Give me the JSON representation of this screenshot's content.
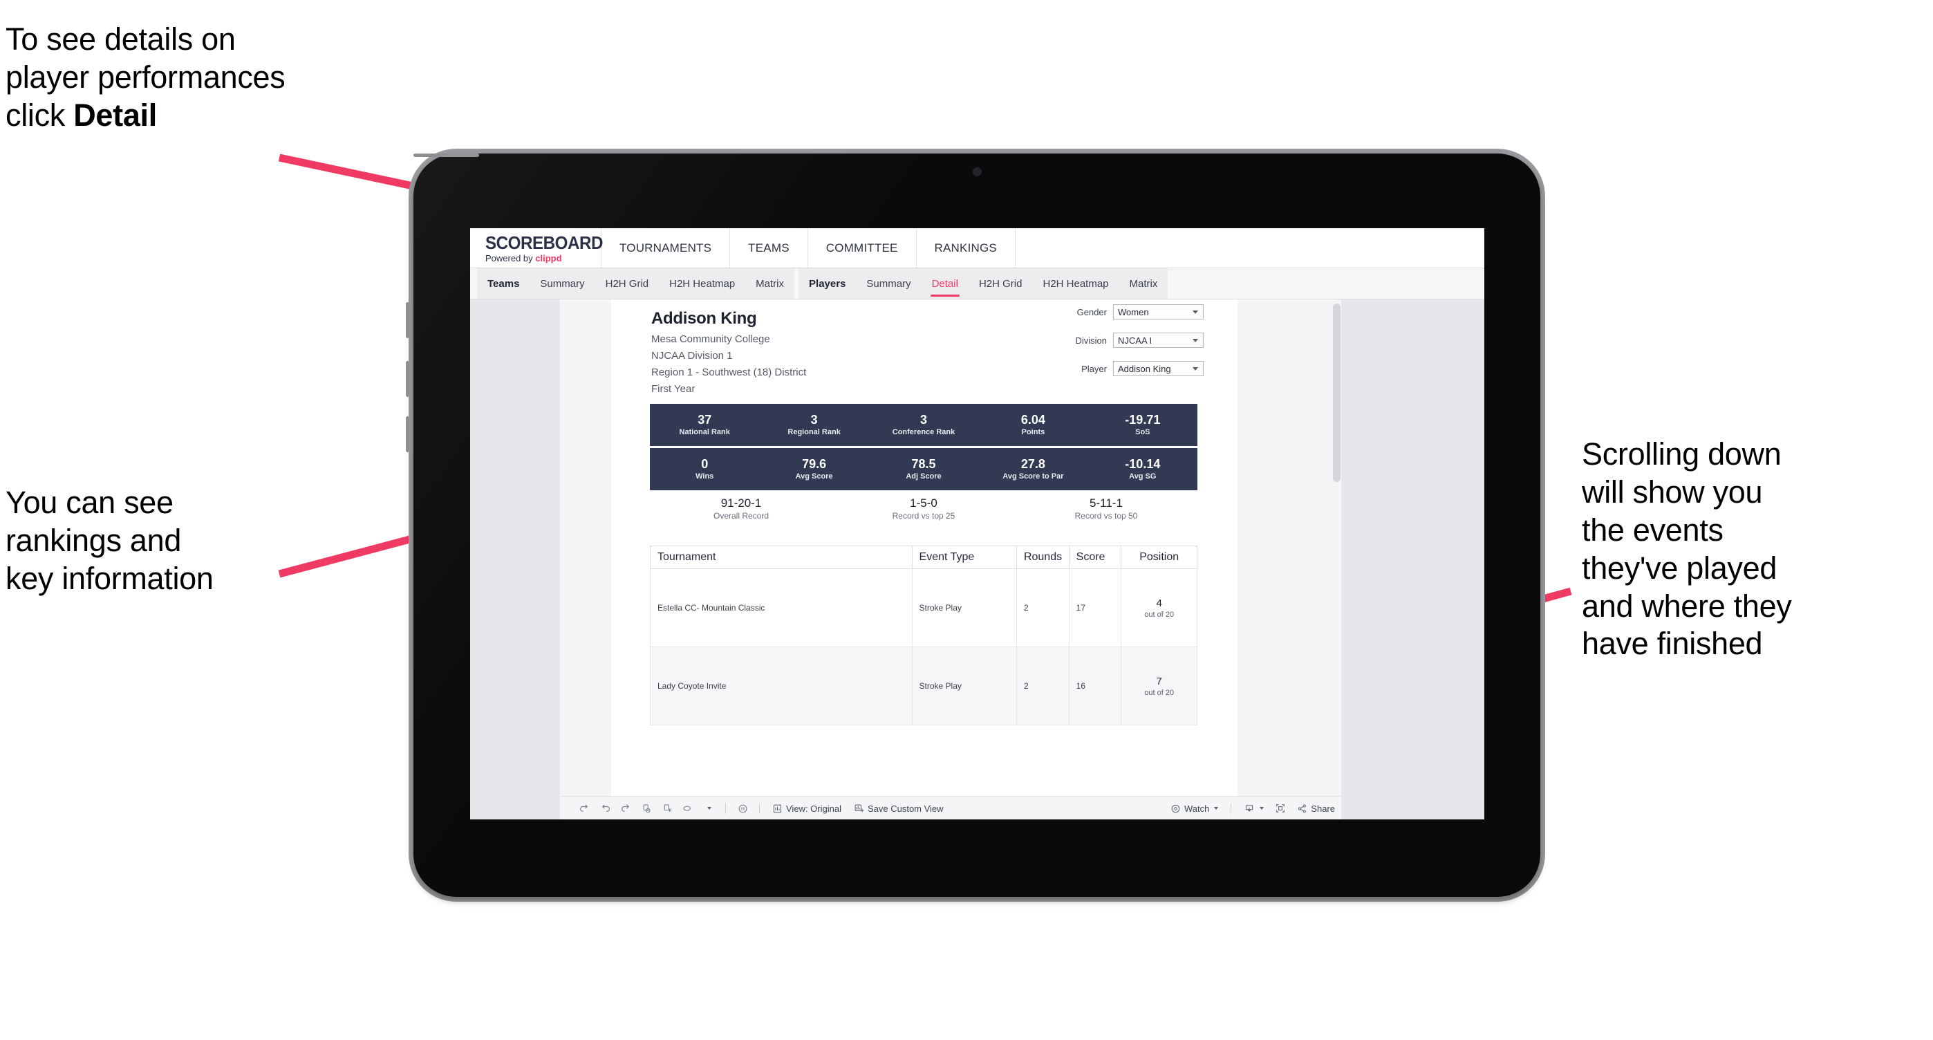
{
  "annotations": {
    "top_left": "To see details on\nplayer performances\nclick ",
    "top_left_bold": "Detail",
    "mid_left": "You can see\nrankings and\nkey information",
    "right": "Scrolling down\nwill show you\nthe events\nthey've played\nand where they\nhave finished",
    "arrow_color": "#ef3a63"
  },
  "header": {
    "brand_title": "SCOREBOARD",
    "brand_sub_prefix": "Powered by ",
    "brand_sub_accent": "clippd",
    "nav": [
      {
        "label": "TOURNAMENTS"
      },
      {
        "label": "TEAMS"
      },
      {
        "label": "COMMITTEE"
      },
      {
        "label": "RANKINGS"
      }
    ]
  },
  "tabbar": {
    "group_teams": [
      {
        "label": "Teams",
        "active": false,
        "head": true
      },
      {
        "label": "Summary",
        "active": false,
        "head": false
      },
      {
        "label": "H2H Grid",
        "active": false,
        "head": false
      },
      {
        "label": "H2H Heatmap",
        "active": false,
        "head": false
      },
      {
        "label": "Matrix",
        "active": false,
        "head": false
      }
    ],
    "group_players": [
      {
        "label": "Players",
        "active": false,
        "head": true
      },
      {
        "label": "Summary",
        "active": false,
        "head": false
      },
      {
        "label": "Detail",
        "active": true,
        "head": false
      },
      {
        "label": "H2H Grid",
        "active": false,
        "head": false
      },
      {
        "label": "H2H Heatmap",
        "active": false,
        "head": false
      },
      {
        "label": "Matrix",
        "active": false,
        "head": false
      }
    ]
  },
  "player": {
    "name": "Addison King",
    "school": "Mesa Community College",
    "division": "NJCAA Division 1",
    "region": "Region 1 - Southwest (18) District",
    "year": "First Year"
  },
  "selectors": [
    {
      "label": "Gender",
      "value": "Women"
    },
    {
      "label": "Division",
      "value": "NJCAA I"
    },
    {
      "label": "Player",
      "value": "Addison King"
    }
  ],
  "stats_band_1": [
    {
      "value": "37",
      "label": "National Rank"
    },
    {
      "value": "3",
      "label": "Regional Rank"
    },
    {
      "value": "3",
      "label": "Conference Rank"
    },
    {
      "value": "6.04",
      "label": "Points"
    },
    {
      "value": "-19.71",
      "label": "SoS"
    }
  ],
  "stats_band_2": [
    {
      "value": "0",
      "label": "Wins"
    },
    {
      "value": "79.6",
      "label": "Avg Score"
    },
    {
      "value": "78.5",
      "label": "Adj Score"
    },
    {
      "value": "27.8",
      "label": "Avg Score to Par"
    },
    {
      "value": "-10.14",
      "label": "Avg SG"
    }
  ],
  "records": [
    {
      "value": "91-20-1",
      "label": "Overall Record"
    },
    {
      "value": "1-5-0",
      "label": "Record vs top 25"
    },
    {
      "value": "5-11-1",
      "label": "Record vs top 50"
    }
  ],
  "table": {
    "columns": [
      "Tournament",
      "Event Type",
      "Rounds",
      "Score",
      "Position"
    ],
    "rows": [
      {
        "tournament": "Estella CC- Mountain Classic",
        "event_type": "Stroke Play",
        "rounds": "2",
        "score": "17",
        "position": "4",
        "position_sub": "out of 20"
      },
      {
        "tournament": "Lady Coyote Invite",
        "event_type": "Stroke Play",
        "rounds": "2",
        "score": "16",
        "position": "7",
        "position_sub": "out of 20"
      }
    ]
  },
  "toolbar": {
    "icons": [
      "undo-icon",
      "redo-icon",
      "revert-icon",
      "refresh-data-icon",
      "pause-icon",
      "shape-icon"
    ],
    "view_label": "View: Original",
    "save_label": "Save Custom View",
    "watch_label": "Watch",
    "share_label": "Share"
  },
  "colors": {
    "accent_pink": "#ef3a63",
    "band_navy": "#323a53",
    "brand_navy": "#2b3147"
  }
}
